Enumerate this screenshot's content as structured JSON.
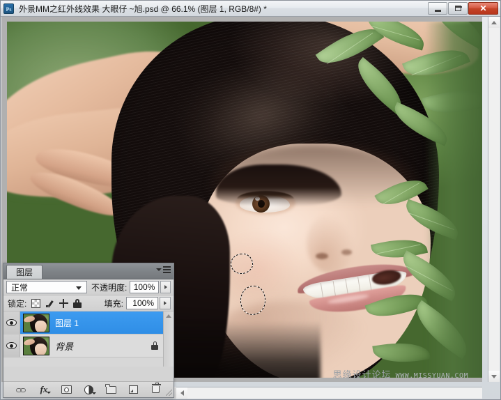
{
  "window": {
    "app_icon": "photoshop-logo-icon",
    "title": "外景MM之红外线效果 大眼仔 ~旭.psd @ 66.1% (图层 1, RGB/8#) *",
    "controls": {
      "minimize": "minimize-icon",
      "maximize": "maximize-icon",
      "close": "close-icon"
    }
  },
  "canvas": {
    "zoom_level": "66.1%",
    "document_name": "外景MM之红外线效果 大眼仔 ~旭.psd",
    "color_mode": "RGB/8#",
    "active_layer": "图层 1",
    "modified": "*",
    "background_color": "#b0b0b0",
    "selections": [
      {
        "name": "elliptical-selection-upper",
        "shape": "ellipse"
      },
      {
        "name": "elliptical-selection-lower",
        "shape": "ellipse"
      }
    ]
  },
  "watermark": {
    "site_cn": "思缘设计论坛",
    "site_url": "WWW.MISSYUAN.COM"
  },
  "layers_panel": {
    "tab_label": "图层",
    "menu_icon": "panel-menu-icon",
    "blend_mode": {
      "label": "",
      "value": "正常"
    },
    "opacity": {
      "label": "不透明度:",
      "value": "100%"
    },
    "lock": {
      "label": "锁定:",
      "icons": [
        "lock-transparent-pixels-icon",
        "lock-image-pixels-icon",
        "lock-position-icon",
        "lock-all-icon"
      ]
    },
    "fill": {
      "label": "填充:",
      "value": "100%"
    },
    "layers": [
      {
        "name": "图层 1",
        "visible": true,
        "selected": true,
        "locked": false,
        "thumbnail": "layer-thumbnail-portrait"
      },
      {
        "name": "背景",
        "visible": true,
        "selected": false,
        "locked": true,
        "thumbnail": "layer-thumbnail-portrait"
      }
    ],
    "footer_buttons": [
      "link-layers-icon",
      "layer-style-fx-icon",
      "add-layer-mask-icon",
      "new-adjustment-layer-icon",
      "new-group-icon",
      "new-layer-icon",
      "delete-layer-icon"
    ],
    "accent_selected_color": "#3d9bf0"
  },
  "scrollbars": {
    "vertical": "vertical-scrollbar",
    "horizontal": "horizontal-scrollbar"
  }
}
